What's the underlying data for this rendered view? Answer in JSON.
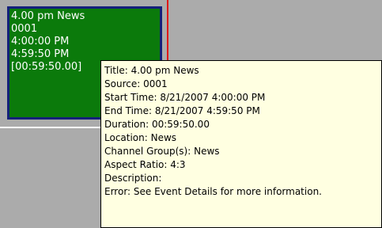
{
  "event": {
    "title": "4.00 pm News",
    "source": "0001",
    "start": "4:00:00 PM",
    "end": "4:59:50 PM",
    "duration": "[00:59:50.00]"
  },
  "tooltip": {
    "rows": [
      "Title: 4.00 pm News",
      "Source: 0001",
      "Start Time: 8/21/2007 4:00:00 PM",
      "End Time: 8/21/2007 4:59:50 PM",
      "Duration: 00:59:50.00",
      "Location: News",
      "Channel Group(s): News",
      "Aspect Ratio: 4:3",
      "Description:",
      "Error: See Event Details for more information."
    ]
  },
  "colors": {
    "event_fill": "#0b7a0b",
    "event_border": "#14207a",
    "tooltip_background": "#ffffe1",
    "lane_background": "#ababab",
    "time_marker": "#e01818"
  }
}
